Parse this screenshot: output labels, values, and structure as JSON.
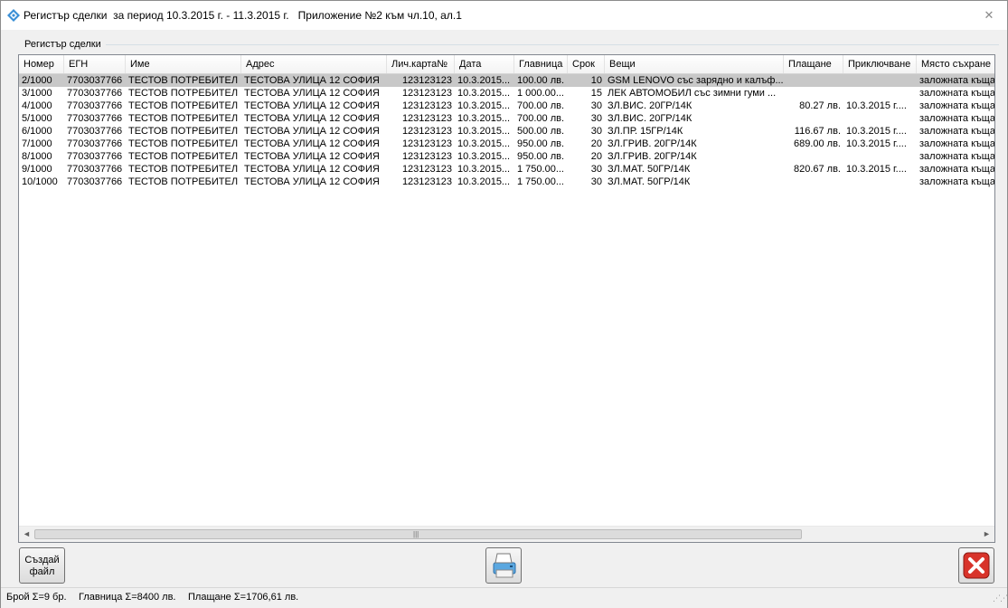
{
  "window": {
    "title": "Регистър сделки  за период 10.3.2015 г. - 11.3.2015 г.   Приложение №2 към чл.10, ал.1",
    "close_glyph": "✕"
  },
  "group": {
    "label": "Регистър сделки"
  },
  "table": {
    "columns": [
      "Номер",
      "ЕГН",
      "Име",
      "Адрес",
      "Лич.карта№",
      "Дата",
      "Главница",
      "Срок",
      "Вещи",
      "Плащане",
      "Приключване",
      "Място съхране"
    ],
    "rows": [
      [
        "2/1000",
        "7703037766",
        "ТЕСТОВ ПОТРЕБИТЕЛ",
        "ТЕСТОВА УЛИЦА 12  СОФИЯ",
        "123123123",
        "10.3.2015...",
        "100.00 лв.",
        "10",
        "GSM LENOVO със зарядно и калъф...",
        "",
        "",
        "заложната къща..."
      ],
      [
        "3/1000",
        "7703037766",
        "ТЕСТОВ ПОТРЕБИТЕЛ",
        "ТЕСТОВА УЛИЦА 12  СОФИЯ",
        "123123123",
        "10.3.2015...",
        "1 000.00...",
        "15",
        "ЛЕК АВТОМОБИЛ със зимни гуми ...",
        "",
        "",
        "заложната къща..."
      ],
      [
        "4/1000",
        "7703037766",
        "ТЕСТОВ ПОТРЕБИТЕЛ",
        "ТЕСТОВА УЛИЦА 12  СОФИЯ",
        "123123123",
        "10.3.2015...",
        "700.00 лв.",
        "30",
        "ЗЛ.ВИС. 20ГР/14К",
        "80.27 лв.",
        "10.3.2015 г....",
        "заложната къща..."
      ],
      [
        "5/1000",
        "7703037766",
        "ТЕСТОВ ПОТРЕБИТЕЛ",
        "ТЕСТОВА УЛИЦА 12  СОФИЯ",
        "123123123",
        "10.3.2015...",
        "700.00 лв.",
        "30",
        "ЗЛ.ВИС. 20ГР/14К",
        "",
        "",
        "заложната къща..."
      ],
      [
        "6/1000",
        "7703037766",
        "ТЕСТОВ ПОТРЕБИТЕЛ",
        "ТЕСТОВА УЛИЦА 12  СОФИЯ",
        "123123123",
        "10.3.2015...",
        "500.00 лв.",
        "30",
        "ЗЛ.ПР. 15ГР/14К",
        "116.67 лв.",
        "10.3.2015 г....",
        "заложната къща..."
      ],
      [
        "7/1000",
        "7703037766",
        "ТЕСТОВ ПОТРЕБИТЕЛ",
        "ТЕСТОВА УЛИЦА 12  СОФИЯ",
        "123123123",
        "10.3.2015...",
        "950.00 лв.",
        "20",
        "ЗЛ.ГРИВ. 20ГР/14К",
        "689.00 лв.",
        "10.3.2015 г....",
        "заложната къща..."
      ],
      [
        "8/1000",
        "7703037766",
        "ТЕСТОВ ПОТРЕБИТЕЛ",
        "ТЕСТОВА УЛИЦА 12  СОФИЯ",
        "123123123",
        "10.3.2015...",
        "950.00 лв.",
        "20",
        "ЗЛ.ГРИВ. 20ГР/14К",
        "",
        "",
        "заложната къща..."
      ],
      [
        "9/1000",
        "7703037766",
        "ТЕСТОВ ПОТРЕБИТЕЛ",
        "ТЕСТОВА УЛИЦА 12  СОФИЯ",
        "123123123",
        "10.3.2015...",
        "1 750.00...",
        "30",
        "ЗЛ.МАТ. 50ГР/14К",
        "820.67 лв.",
        "10.3.2015 г....",
        "заложната къща..."
      ],
      [
        "10/1000",
        "7703037766",
        "ТЕСТОВ ПОТРЕБИТЕЛ",
        "ТЕСТОВА УЛИЦА 12  СОФИЯ",
        "123123123",
        "10.3.2015...",
        "1 750.00...",
        "30",
        "ЗЛ.МАТ. 50ГР/14К",
        "",
        "",
        "заложната къща..."
      ]
    ],
    "selected_row_index": 0
  },
  "scrollbar": {
    "left_arrow": "◄",
    "right_arrow": "►",
    "grip": "|||"
  },
  "buttons": {
    "create_file_line1": "Създай",
    "create_file_line2": "файл",
    "print_icon": "printer-icon",
    "close_icon": "close-icon",
    "close_color": "#d8332a"
  },
  "status": {
    "count": "Брой Σ=9 бр.",
    "principal": "Главница Σ=8400 лв.",
    "payment": "Плащане Σ=1706,61 лв.",
    "grip": "⋰⋰"
  }
}
